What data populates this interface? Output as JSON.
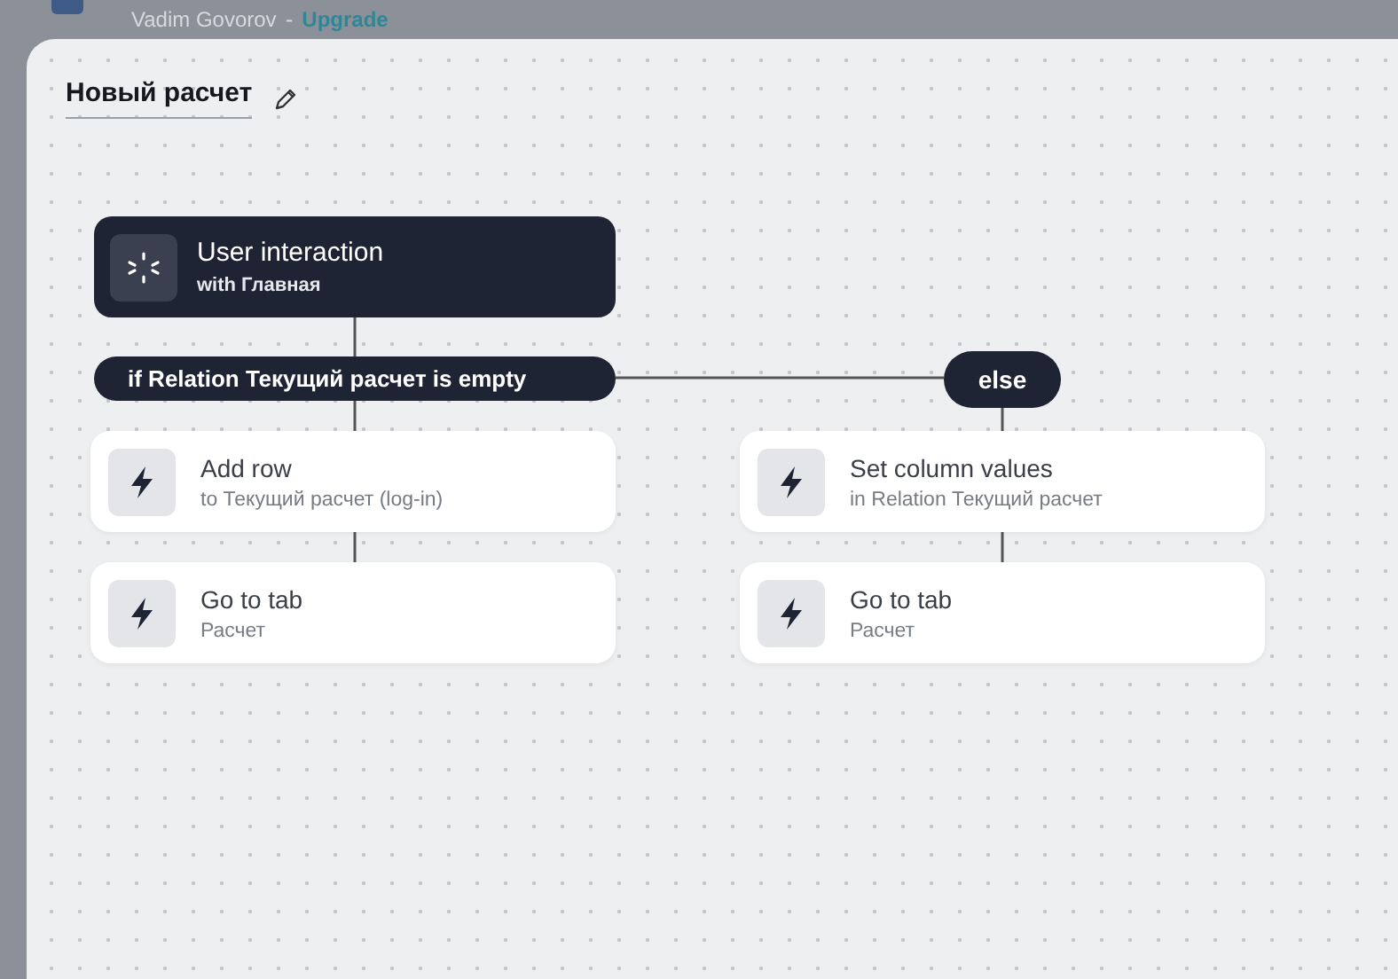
{
  "header": {
    "user": "Vadim Govorov",
    "separator": "-",
    "link": "Upgrade"
  },
  "title": "Новый расчет",
  "trigger": {
    "title": "User interaction",
    "subtitle": "with Главная"
  },
  "condition": {
    "label": "if Relation Текущий расчет is empty"
  },
  "branches": [
    {
      "actions": [
        {
          "title": "Add row",
          "subtitle": "to Текущий расчет (log-in)"
        },
        {
          "title": "Go to tab",
          "subtitle": "Расчет"
        }
      ]
    },
    {
      "label": "else",
      "actions": [
        {
          "title": "Set column values",
          "subtitle": "in Relation Текущий расчет"
        },
        {
          "title": "Go to tab",
          "subtitle": "Расчет"
        }
      ]
    }
  ]
}
